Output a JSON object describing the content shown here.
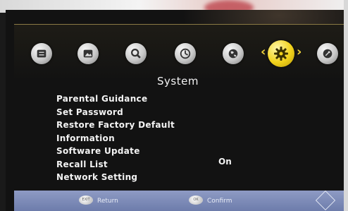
{
  "menu": {
    "icons": [
      {
        "name": "channel-list",
        "active": false
      },
      {
        "name": "picture",
        "active": false
      },
      {
        "name": "search",
        "active": false
      },
      {
        "name": "time",
        "active": false
      },
      {
        "name": "language",
        "active": false
      },
      {
        "name": "system",
        "active": true
      },
      {
        "name": "usb",
        "active": false
      }
    ],
    "left_arrow": "‹",
    "right_arrow": "›"
  },
  "page": {
    "title": "System",
    "items": [
      {
        "label": "Parental Guidance",
        "value": ""
      },
      {
        "label": "Set Password",
        "value": ""
      },
      {
        "label": "Restore Factory Default",
        "value": ""
      },
      {
        "label": "Information",
        "value": ""
      },
      {
        "label": "Software Update",
        "value": ""
      },
      {
        "label": "Recall List",
        "value": "On"
      },
      {
        "label": "Network Setting",
        "value": ""
      }
    ]
  },
  "footer": {
    "return_key": "EXIT",
    "return_label": "Return",
    "confirm_key": "OK",
    "confirm_label": "Confirm"
  },
  "colors": {
    "active_icon": "#f2d21b",
    "footer_bar": "#7f8cba",
    "text": "#f3f3f3"
  }
}
